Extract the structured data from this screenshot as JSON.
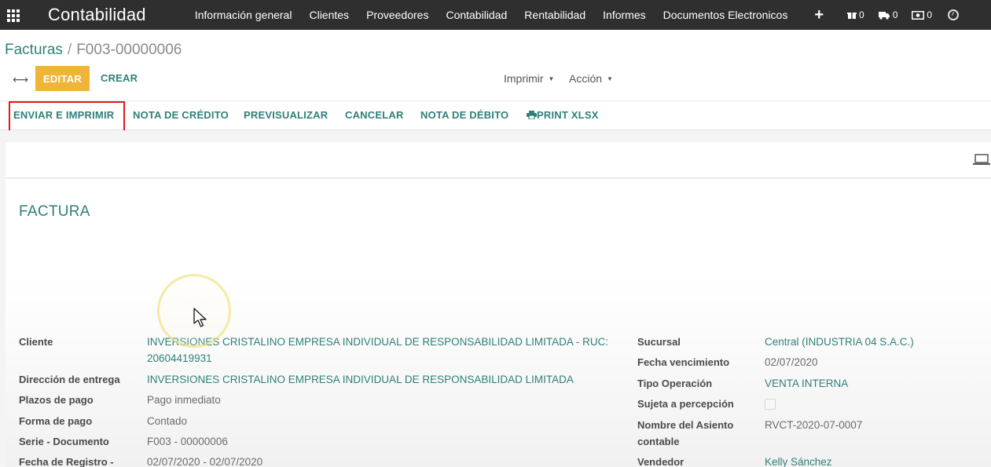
{
  "navbar": {
    "brand": "Contabilidad",
    "menu": [
      {
        "label": "Información general"
      },
      {
        "label": "Clientes"
      },
      {
        "label": "Proveedores"
      },
      {
        "label": "Contabilidad"
      },
      {
        "label": "Rentabilidad"
      },
      {
        "label": "Informes"
      },
      {
        "label": "Documentos Electronicos"
      }
    ],
    "plus": "+",
    "systray": [
      {
        "icon": "gift-icon",
        "count": "0"
      },
      {
        "icon": "truck-icon",
        "count": "0"
      },
      {
        "icon": "money-icon",
        "count": "0"
      }
    ],
    "clock_icon": "clock-icon"
  },
  "breadcrumb": {
    "parent": "Facturas",
    "separator": "/",
    "current": "F003-00000006"
  },
  "controls": {
    "arrows": "⟷",
    "edit_label": "EDITAR",
    "create_label": "CREAR",
    "print_label": "Imprimir",
    "action_label": "Acción"
  },
  "statusbar": {
    "buttons": [
      {
        "label": "ENVIAR E IMPRIMIR"
      },
      {
        "label": "NOTA DE CRÉDITO"
      },
      {
        "label": "PREVISUALIZAR"
      },
      {
        "label": "CANCELAR"
      },
      {
        "label": "NOTA DE DÉBITO"
      },
      {
        "label": "PRINT XLSX"
      }
    ]
  },
  "sheet": {
    "title": "FACTURA",
    "left_fields": [
      {
        "label": "Cliente",
        "value_line1": "INVERSIONES CRISTALINO EMPRESA INDIVIDUAL DE RESPONSABILIDAD LIMITADA - RUC:",
        "value_line2": "20604419931"
      },
      {
        "label": "Dirección de entrega",
        "value": "INVERSIONES CRISTALINO EMPRESA INDIVIDUAL DE RESPONSABILIDAD LIMITADA"
      },
      {
        "label": "Plazos de pago",
        "value": "Pago inmediato"
      },
      {
        "label": "Forma de pago",
        "value": "Contado"
      },
      {
        "label": "Serie - Documento",
        "value": "F003 - 00000006"
      },
      {
        "label": "Fecha de Registro -",
        "value": "02/07/2020 - 02/07/2020"
      }
    ],
    "right_fields": [
      {
        "label": "Sucursal",
        "value": "Central (INDUSTRIA 04 S.A.C.)"
      },
      {
        "label": "Fecha vencimiento",
        "value": "02/07/2020"
      },
      {
        "label": "Tipo Operación",
        "value": "VENTA INTERNA"
      },
      {
        "label": "Sujeta a percepción",
        "checked": false
      },
      {
        "label_line1": "Nombre del Asiento",
        "label_line2": "contable",
        "value": "RVCT-2020-07-0007"
      },
      {
        "label": "Vendedor",
        "value": "Kelly Sánchez"
      }
    ]
  },
  "colors": {
    "navbar_bg": "#2f2f2f",
    "accent": "#2f7f7a",
    "edit_button": "#f0b437",
    "highlight": "#e3161e"
  }
}
